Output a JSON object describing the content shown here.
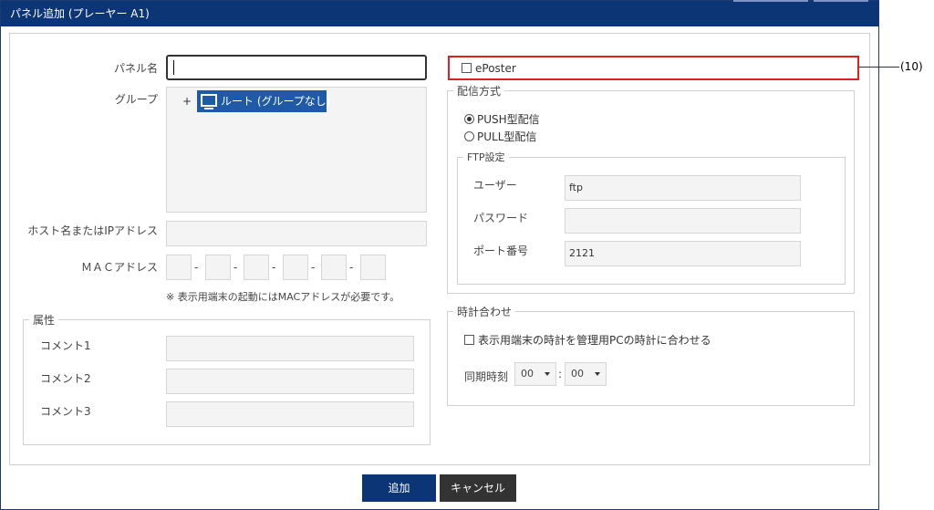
{
  "window": {
    "title": "パネル追加 (プレーヤー A1)"
  },
  "form": {
    "panel_name_label": "パネル名",
    "panel_name_value": "",
    "group_label": "グループ",
    "group_tree": {
      "expand_symbol": "+",
      "root_label": "ルート (グループなし)"
    },
    "host_label": "ホスト名またはIPアドレス",
    "host_value": "",
    "mac_label": "ＭＡＣアドレス",
    "mac_separator": "-",
    "mac_note": "※ 表示用端末の起動にはMACアドレスが必要です。"
  },
  "attributes": {
    "legend": "属性",
    "comment1_label": "コメント1",
    "comment2_label": "コメント2",
    "comment3_label": "コメント3"
  },
  "eposter": {
    "label": "ePoster",
    "checked": false
  },
  "callout": {
    "label": "(10)"
  },
  "delivery": {
    "legend": "配信方式",
    "push_label": "PUSH型配信",
    "pull_label": "PULL型配信",
    "selected": "push"
  },
  "ftp": {
    "legend": "FTP設定",
    "user_label": "ユーザー",
    "user_value": "ftp",
    "password_label": "パスワード",
    "password_value": "",
    "port_label": "ポート番号",
    "port_value": "2121"
  },
  "clock": {
    "legend": "時計合わせ",
    "sync_label": "表示用端末の時計を管理用PCの時計に合わせる",
    "sync_checked": false,
    "time_label": "同期時刻",
    "hour": "00",
    "separator": ":",
    "minute": "00"
  },
  "buttons": {
    "add": "追加",
    "cancel": "キャンセル"
  },
  "colors": {
    "titlebar": "#0c3576",
    "highlight": "#e01f1f",
    "tree_selected": "#1f5aa6"
  }
}
